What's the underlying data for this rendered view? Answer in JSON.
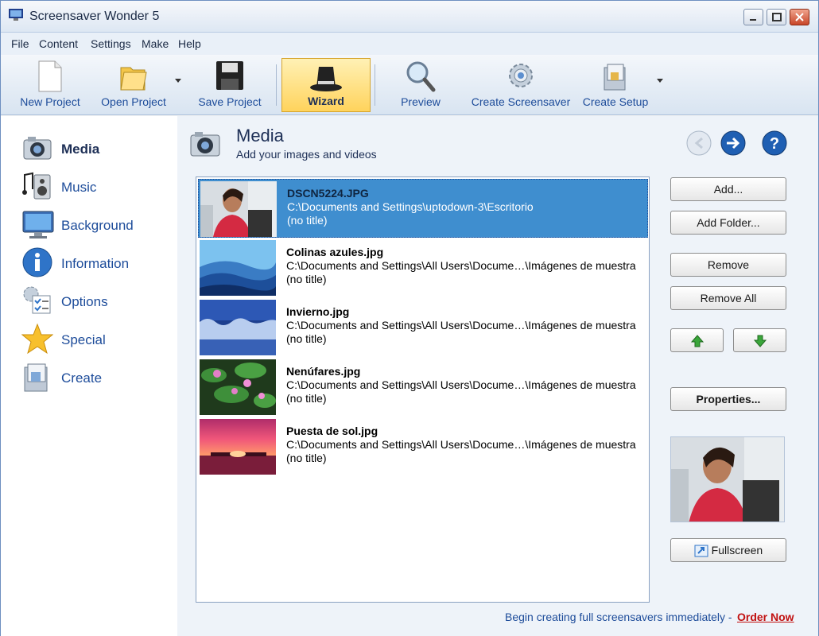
{
  "window": {
    "title": "Screensaver Wonder 5"
  },
  "menu": [
    "File",
    "Content",
    "Settings",
    "Make",
    "Help"
  ],
  "toolbar": {
    "new_project": "New Project",
    "open_project": "Open Project",
    "save_project": "Save Project",
    "wizard": "Wizard",
    "preview": "Preview",
    "create_screensaver": "Create Screensaver",
    "create_setup": "Create Setup"
  },
  "sidebar": {
    "items": [
      {
        "label": "Media",
        "icon": "camera-icon",
        "active": true
      },
      {
        "label": "Music",
        "icon": "speaker-icon",
        "active": false
      },
      {
        "label": "Background",
        "icon": "monitor-icon",
        "active": false
      },
      {
        "label": "Information",
        "icon": "info-icon",
        "active": false
      },
      {
        "label": "Options",
        "icon": "options-icon",
        "active": false
      },
      {
        "label": "Special",
        "icon": "star-icon",
        "active": false
      },
      {
        "label": "Create",
        "icon": "create-icon",
        "active": false
      }
    ]
  },
  "panel": {
    "title": "Media",
    "subtitle": "Add your images and videos"
  },
  "media_list": [
    {
      "name": "DSCN5224.JPG",
      "path": "C:\\Documents and Settings\\uptodown-3\\Escritorio",
      "title": "(no title)",
      "selected": true,
      "thumb": "person-photo"
    },
    {
      "name": "Colinas azules.jpg",
      "path": "C:\\Documents and Settings\\All Users\\Docume…\\Imágenes de muestra",
      "title": "(no title)",
      "selected": false,
      "thumb": "blue-hills"
    },
    {
      "name": "Invierno.jpg",
      "path": "C:\\Documents and Settings\\All Users\\Docume…\\Imágenes de muestra",
      "title": "(no title)",
      "selected": false,
      "thumb": "winter"
    },
    {
      "name": "Nenúfares.jpg",
      "path": "C:\\Documents and Settings\\All Users\\Docume…\\Imágenes de muestra",
      "title": "(no title)",
      "selected": false,
      "thumb": "water-lilies"
    },
    {
      "name": "Puesta de sol.jpg",
      "path": "C:\\Documents and Settings\\All Users\\Docume…\\Imágenes de muestra",
      "title": "(no title)",
      "selected": false,
      "thumb": "sunset"
    }
  ],
  "buttons": {
    "add": "Add...",
    "add_folder": "Add Folder...",
    "remove": "Remove",
    "remove_all": "Remove All",
    "properties": "Properties...",
    "fullscreen": "Fullscreen"
  },
  "footer": {
    "text": "Begin creating full screensavers immediately -",
    "link": "Order Now"
  },
  "colors": {
    "selection": "#3f8ecf",
    "link_blue": "#1d4c9a",
    "order_red": "#c11111",
    "wizard_highlight": "#ffd35c"
  }
}
